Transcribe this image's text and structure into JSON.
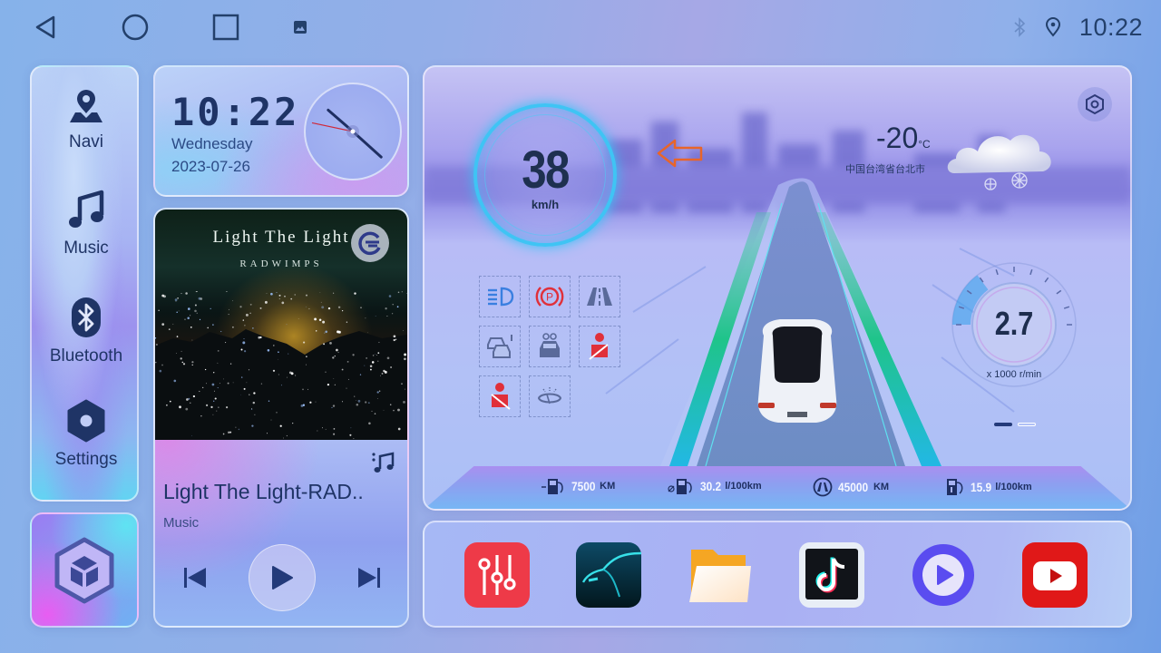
{
  "statusbar": {
    "nav": [
      "back",
      "home",
      "recents",
      "screenshot"
    ],
    "time": "10:22",
    "icons": [
      "bluetooth-icon",
      "location-icon"
    ]
  },
  "sidebar": {
    "items": [
      {
        "label": "Navi",
        "icon": "navigation-pin-icon"
      },
      {
        "label": "Music",
        "icon": "music-note-icon"
      },
      {
        "label": "Bluetooth",
        "icon": "bluetooth-icon"
      },
      {
        "label": "Settings",
        "icon": "settings-hex-icon"
      }
    ],
    "apps_tile_icon": "cube-apps-icon"
  },
  "clock": {
    "digital": "10:22",
    "weekday": "Wednesday",
    "date": "2023-07-26",
    "analog": {
      "hour": 10,
      "minute": 22,
      "second": 47
    }
  },
  "music": {
    "album_title": "Light The Light",
    "album_artist": "RADWIMPS",
    "song_title": "Light The Light-RAD..",
    "source": "Music",
    "controls": [
      "previous",
      "play",
      "next"
    ]
  },
  "dashboard": {
    "speed": "38",
    "speed_unit": "km/h",
    "turn_direction": "left",
    "temperature": "-20",
    "temperature_unit": "°C",
    "location": "中国台湾省台北市",
    "weather": "snow",
    "rpm": "2.7",
    "rpm_unit": "x 1000 r/min",
    "rpm_fraction": 0.27,
    "page_index": 0,
    "page_count": 2,
    "warnings": [
      {
        "name": "headlight-icon",
        "color": "#3a7fe0"
      },
      {
        "name": "parking-brake-icon",
        "color": "#e0303a"
      },
      {
        "name": "lane-icon",
        "color": "#5a6a9a"
      },
      {
        "name": "collision-warning-icon",
        "color": "#5a6a9a"
      },
      {
        "name": "car-alarm-icon",
        "color": "#5a6a9a"
      },
      {
        "name": "seatbelt-passenger-icon",
        "color": "#e0303a"
      },
      {
        "name": "seatbelt-driver-icon",
        "color": "#e0303a"
      },
      {
        "name": "washer-icon",
        "color": "#5a6a9a"
      }
    ],
    "trip": [
      {
        "icon": "range-fuel-icon",
        "value": "7500",
        "unit": "KM"
      },
      {
        "icon": "avg-fuel-icon",
        "value": "30.2",
        "unit": "l/100km"
      },
      {
        "icon": "odometer-road-icon",
        "value": "45000",
        "unit": "KM"
      },
      {
        "icon": "fuel-consumption-icon",
        "value": "15.9",
        "unit": "l/100km"
      }
    ]
  },
  "dock": {
    "apps": [
      {
        "name": "equalizer-app",
        "color": "#ee3a48"
      },
      {
        "name": "car-app",
        "color": "#0b3a4a"
      },
      {
        "name": "files-app",
        "color": "#f5a623"
      },
      {
        "name": "tiktok-app",
        "color": "#111111"
      },
      {
        "name": "video-player-app",
        "color": "#5a4cf0"
      },
      {
        "name": "youtube-app",
        "color": "#e01818"
      }
    ]
  }
}
